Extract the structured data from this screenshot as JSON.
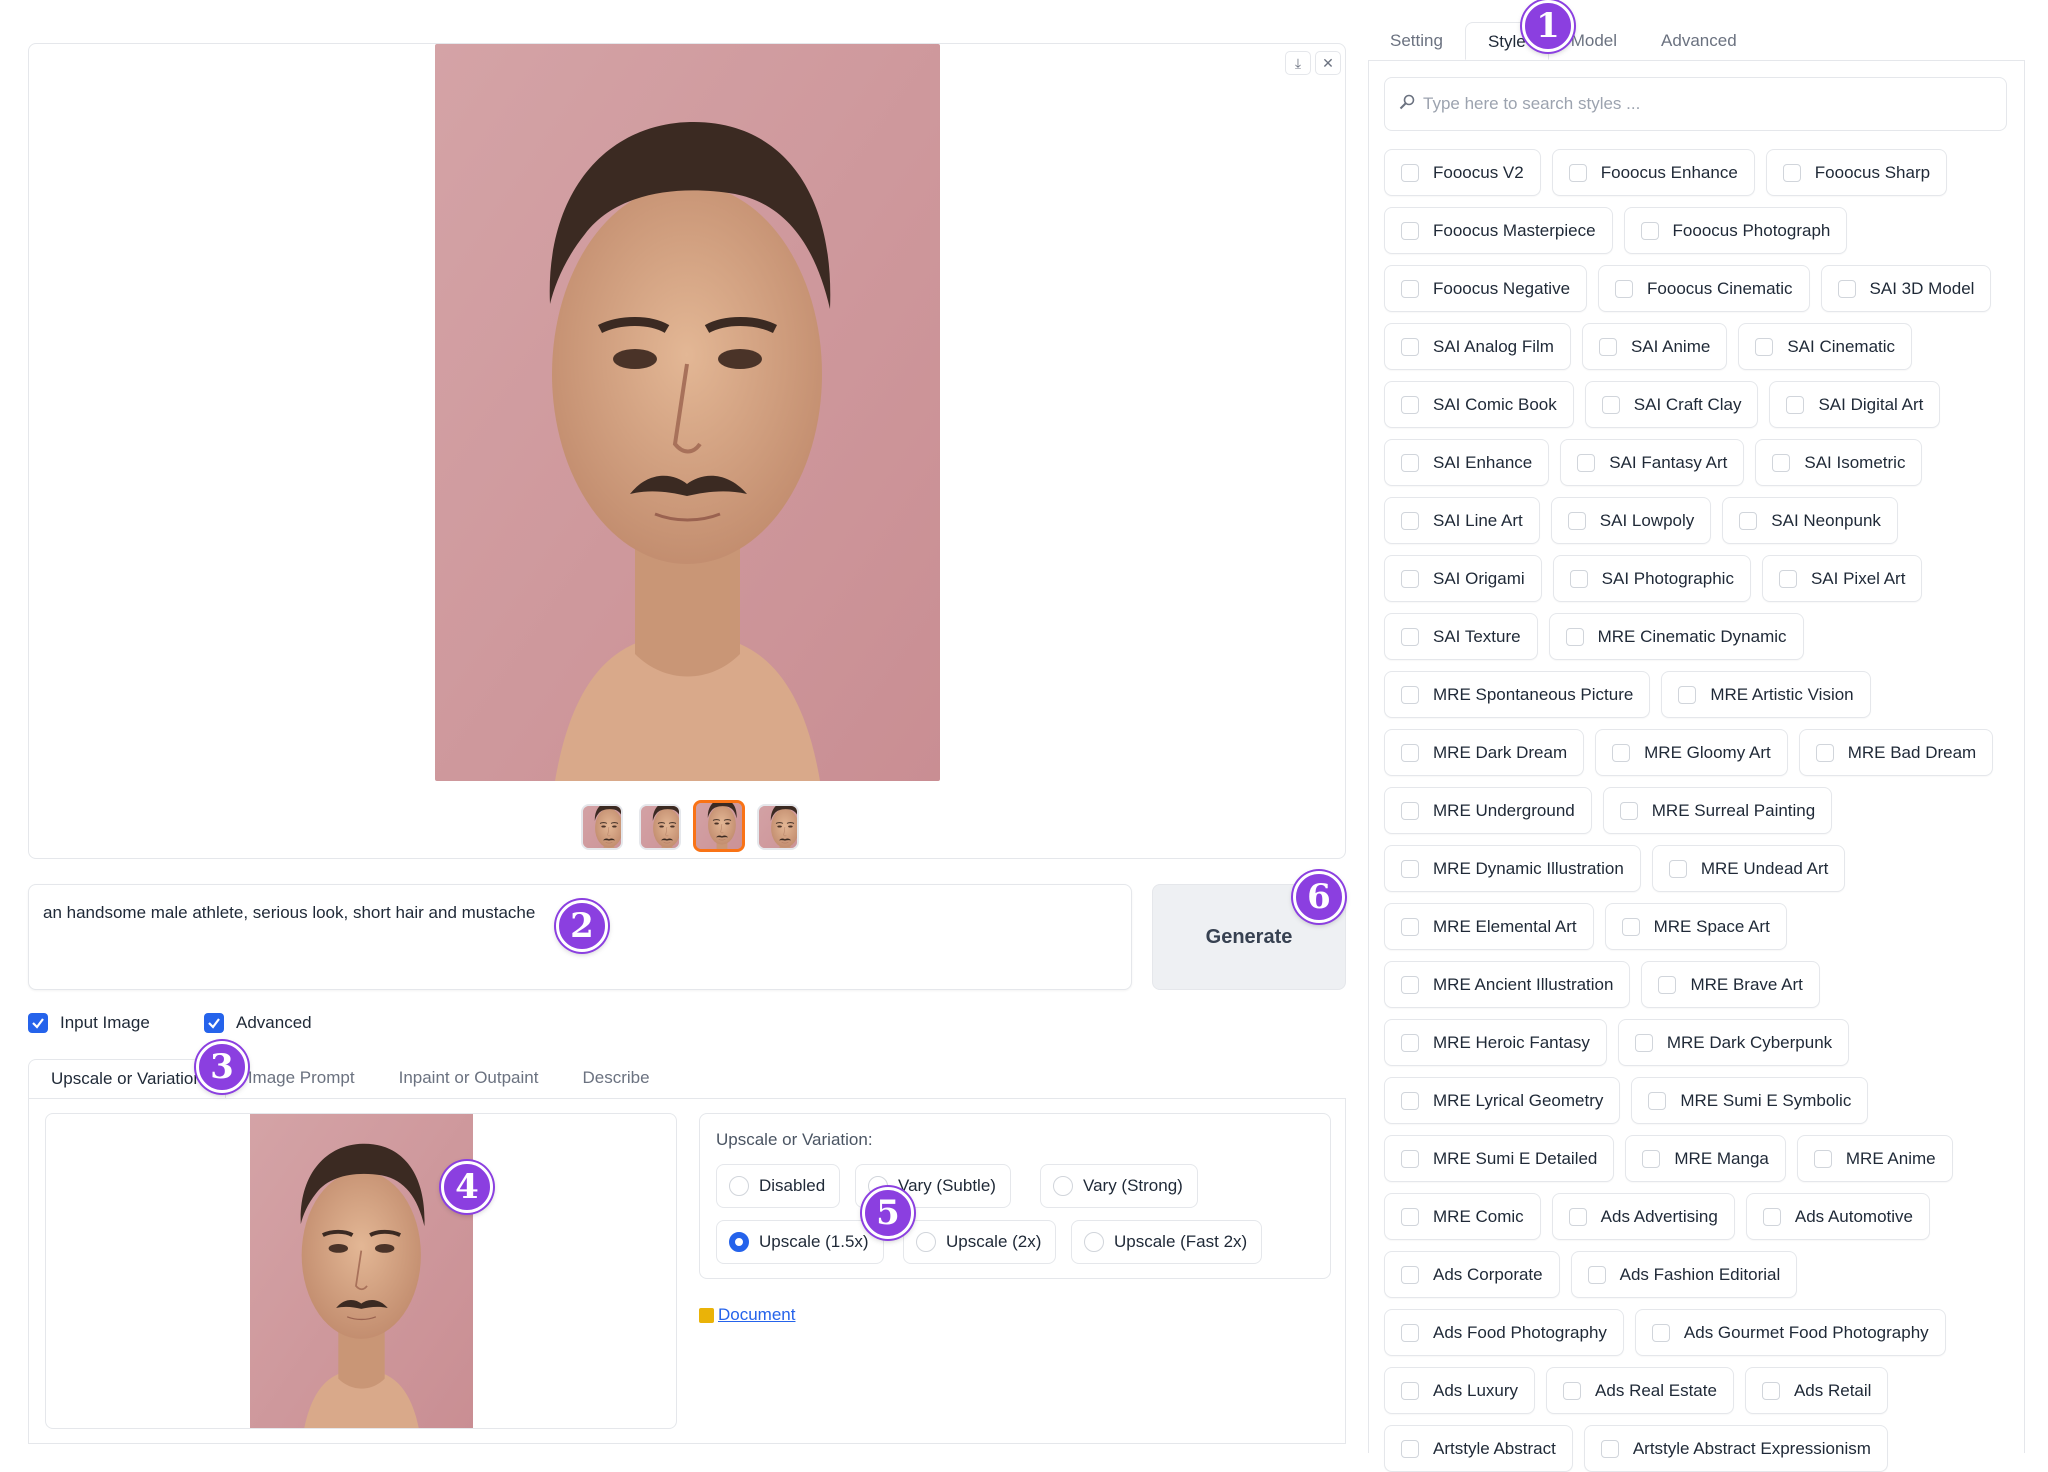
{
  "gallery": {
    "download_icon": "download-icon",
    "close_icon": "close-icon",
    "thumbnails": [
      {
        "name": "thumb-1",
        "selected": false
      },
      {
        "name": "thumb-2",
        "selected": false
      },
      {
        "name": "thumb-3",
        "selected": true
      },
      {
        "name": "thumb-4",
        "selected": false
      }
    ]
  },
  "prompt": {
    "value": "an handsome male athlete, serious look, short hair and mustache"
  },
  "generate": {
    "label": "Generate"
  },
  "options": {
    "input_image_label": "Input Image",
    "advanced_label": "Advanced"
  },
  "input_tabs": [
    "Upscale or Variation",
    "Image Prompt",
    "Inpaint or Outpaint",
    "Describe"
  ],
  "upscale": {
    "label": "Upscale or Variation:",
    "choices": [
      "Disabled",
      "Vary (Subtle)",
      "Vary (Strong)",
      "Upscale (1.5x)",
      "Upscale (2x)",
      "Upscale (Fast 2x)"
    ],
    "selected": "Upscale (1.5x)"
  },
  "document_link": "Document",
  "right_tabs": [
    "Setting",
    "Style",
    "Model",
    "Advanced"
  ],
  "style_search": {
    "placeholder": "Type here to search styles ..."
  },
  "styles": [
    "Fooocus V2",
    "Fooocus Enhance",
    "Fooocus Sharp",
    "Fooocus Masterpiece",
    "Fooocus Photograph",
    "Fooocus Negative",
    "Fooocus Cinematic",
    "SAI 3D Model",
    "SAI Analog Film",
    "SAI Anime",
    "SAI Cinematic",
    "SAI Comic Book",
    "SAI Craft Clay",
    "SAI Digital Art",
    "SAI Enhance",
    "SAI Fantasy Art",
    "SAI Isometric",
    "SAI Line Art",
    "SAI Lowpoly",
    "SAI Neonpunk",
    "SAI Origami",
    "SAI Photographic",
    "SAI Pixel Art",
    "SAI Texture",
    "MRE Cinematic Dynamic",
    "MRE Spontaneous Picture",
    "MRE Artistic Vision",
    "MRE Dark Dream",
    "MRE Gloomy Art",
    "MRE Bad Dream",
    "MRE Underground",
    "MRE Surreal Painting",
    "MRE Dynamic Illustration",
    "MRE Undead Art",
    "MRE Elemental Art",
    "MRE Space Art",
    "MRE Ancient Illustration",
    "MRE Brave Art",
    "MRE Heroic Fantasy",
    "MRE Dark Cyberpunk",
    "MRE Lyrical Geometry",
    "MRE Sumi E Symbolic",
    "MRE Sumi E Detailed",
    "MRE Manga",
    "MRE Anime",
    "MRE Comic",
    "Ads Advertising",
    "Ads Automotive",
    "Ads Corporate",
    "Ads Fashion Editorial",
    "Ads Food Photography",
    "Ads Gourmet Food Photography",
    "Ads Luxury",
    "Ads Real Estate",
    "Ads Retail",
    "Artstyle Abstract",
    "Artstyle Abstract Expressionism"
  ],
  "annotations": [
    "1",
    "2",
    "3",
    "4",
    "5",
    "6"
  ],
  "colors": {
    "accent": "#2563eb",
    "selected_thumb_border": "#f97316",
    "badge": "#8b3fe0",
    "image_background": "#d9a5a5"
  }
}
